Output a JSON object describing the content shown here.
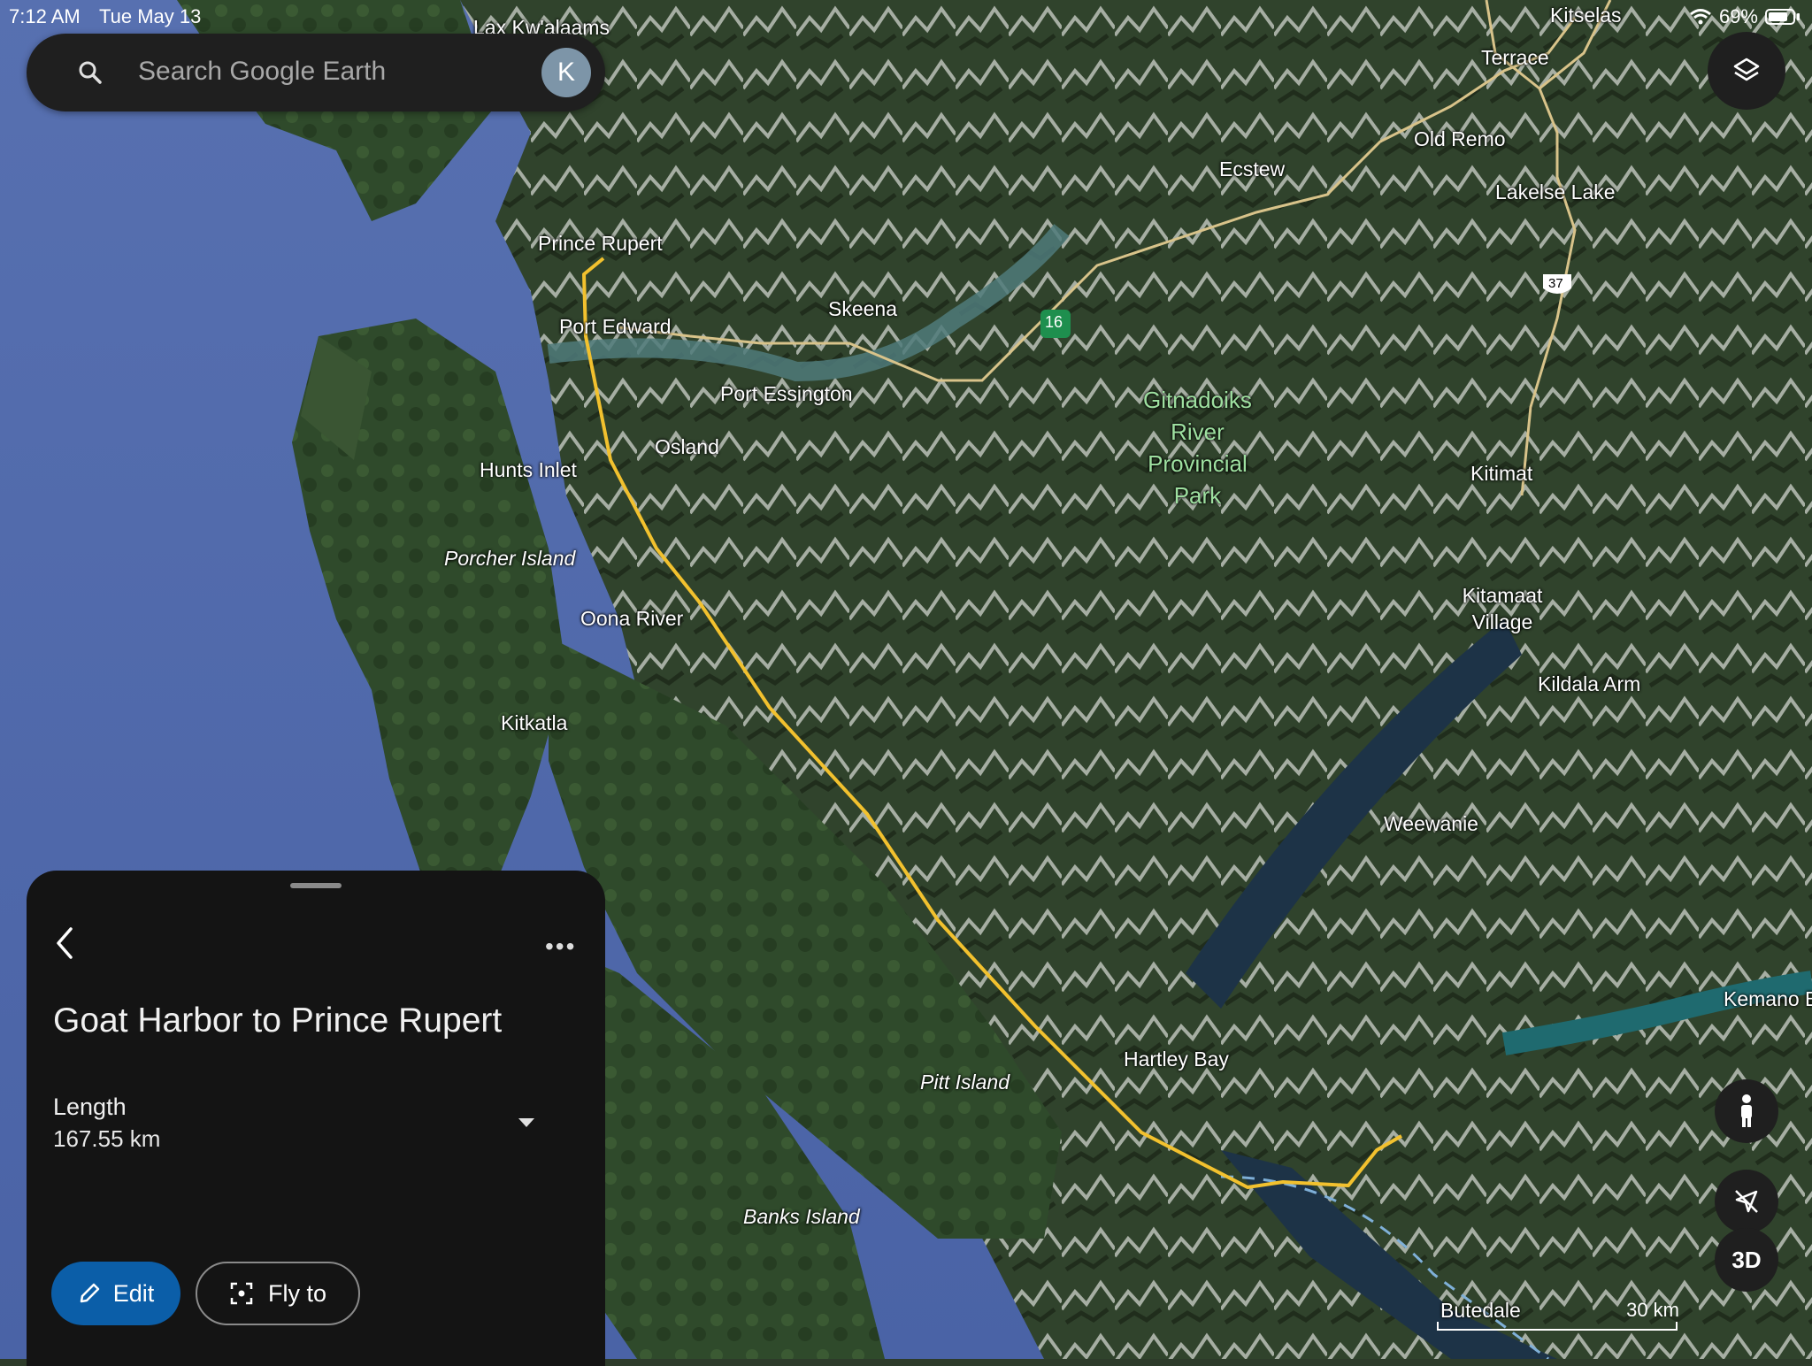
{
  "status_bar": {
    "time": "7:12 AM",
    "date": "Tue May 13",
    "battery": "69%"
  },
  "search": {
    "placeholder": "Search Google Earth",
    "avatar_initial": "K"
  },
  "map": {
    "places": [
      {
        "id": "lax-kwalaams",
        "label": "Lax Kw'alaams"
      },
      {
        "id": "kitselas",
        "label": "Kitselas"
      },
      {
        "id": "terrace",
        "label": "Terrace"
      },
      {
        "id": "old-remo",
        "label": "Old Remo"
      },
      {
        "id": "ecstew",
        "label": "Ecstew"
      },
      {
        "id": "lakelse-lake",
        "label": "Lakelse Lake"
      },
      {
        "id": "prince-rupert",
        "label": "Prince Rupert"
      },
      {
        "id": "port-edward",
        "label": "Port Edward"
      },
      {
        "id": "skeena",
        "label": "Skeena"
      },
      {
        "id": "port-essington",
        "label": "Port Essington"
      },
      {
        "id": "osland",
        "label": "Osland"
      },
      {
        "id": "hunts-inlet",
        "label": "Hunts Inlet"
      },
      {
        "id": "porcher-island",
        "label": "Porcher Island"
      },
      {
        "id": "oona-river",
        "label": "Oona River"
      },
      {
        "id": "kitkatla",
        "label": "Kitkatla"
      },
      {
        "id": "kitimat",
        "label": "Kitimat"
      },
      {
        "id": "kitamaat-village",
        "label": "Kitamaat Village"
      },
      {
        "id": "kildala-arm",
        "label": "Kildala Arm"
      },
      {
        "id": "weewanie",
        "label": "Weewanie"
      },
      {
        "id": "kemano",
        "label": "Kemano B"
      },
      {
        "id": "hartley-bay",
        "label": "Hartley Bay"
      },
      {
        "id": "pitt-island",
        "label": "Pitt Island"
      },
      {
        "id": "banks-island",
        "label": "Banks Island"
      },
      {
        "id": "butedale",
        "label": "Butedale"
      }
    ],
    "park_label": "Gitnadoiks River Provincial Park",
    "park_label_lines": [
      "Gitnadoiks",
      "River",
      "Provincial",
      "Park"
    ],
    "highway_shield": "37",
    "route_shield": "16",
    "scale_label": "30 km",
    "route_color": "#f2c12e"
  },
  "panel": {
    "title": "Goat Harbor to Prince Rupert",
    "length_label": "Length",
    "length_value": "167.55 km",
    "edit_label": "Edit",
    "fly_label": "Fly to"
  },
  "controls": {
    "view_mode": "3D"
  }
}
